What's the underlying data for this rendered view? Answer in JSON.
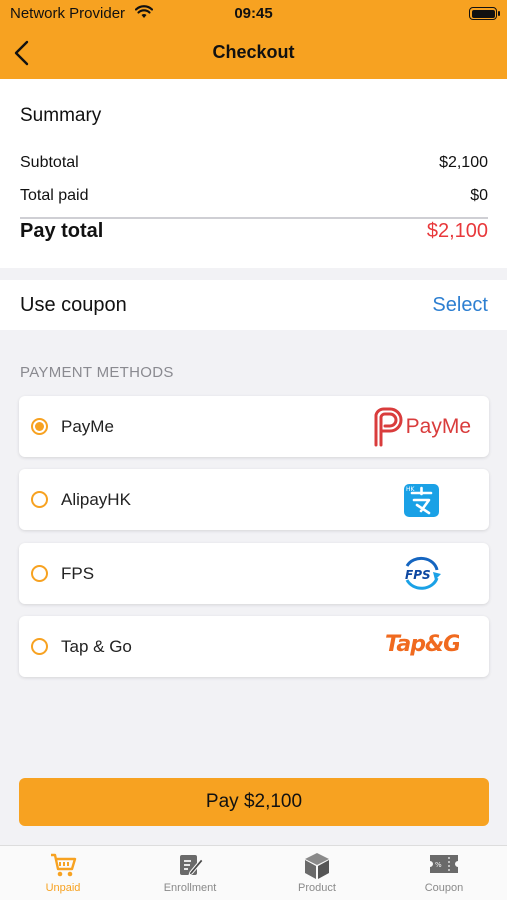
{
  "status": {
    "carrier": "Network Provider",
    "time": "09:45"
  },
  "nav": {
    "title": "Checkout",
    "back_icon": "chevron-left-icon"
  },
  "summary": {
    "title": "Summary",
    "subtotal_label": "Subtotal",
    "subtotal_value": "$2,100",
    "total_paid_label": "Total paid",
    "total_paid_value": "$0",
    "pay_total_label": "Pay total",
    "pay_total_value": "$2,100"
  },
  "coupon": {
    "label": "Use coupon",
    "action": "Select"
  },
  "payment": {
    "header": "PAYMENT METHODS",
    "methods": [
      {
        "name": "PayMe",
        "selected": true,
        "logo_text": "PayMe",
        "logo_icon": "payme-logo-icon"
      },
      {
        "name": "AlipayHK",
        "selected": false,
        "logo_icon": "alipayhk-logo-icon"
      },
      {
        "name": "FPS",
        "selected": false,
        "logo_text": "FPS",
        "logo_icon": "fps-logo-icon"
      },
      {
        "name": "Tap & Go",
        "selected": false,
        "logo_text": "Tap&Go",
        "logo_icon": "tapngo-logo-icon"
      }
    ]
  },
  "pay_button": {
    "label": "Pay $2,100"
  },
  "tabs": [
    {
      "label": "Unpaid",
      "icon": "cart-icon",
      "active": true
    },
    {
      "label": "Enrollment",
      "icon": "edit-document-icon",
      "active": false
    },
    {
      "label": "Product",
      "icon": "box-icon",
      "active": false
    },
    {
      "label": "Coupon",
      "icon": "ticket-icon",
      "active": false
    }
  ],
  "colors": {
    "accent": "#f7a221",
    "price": "#e8383b",
    "link": "#2d7fd1"
  }
}
